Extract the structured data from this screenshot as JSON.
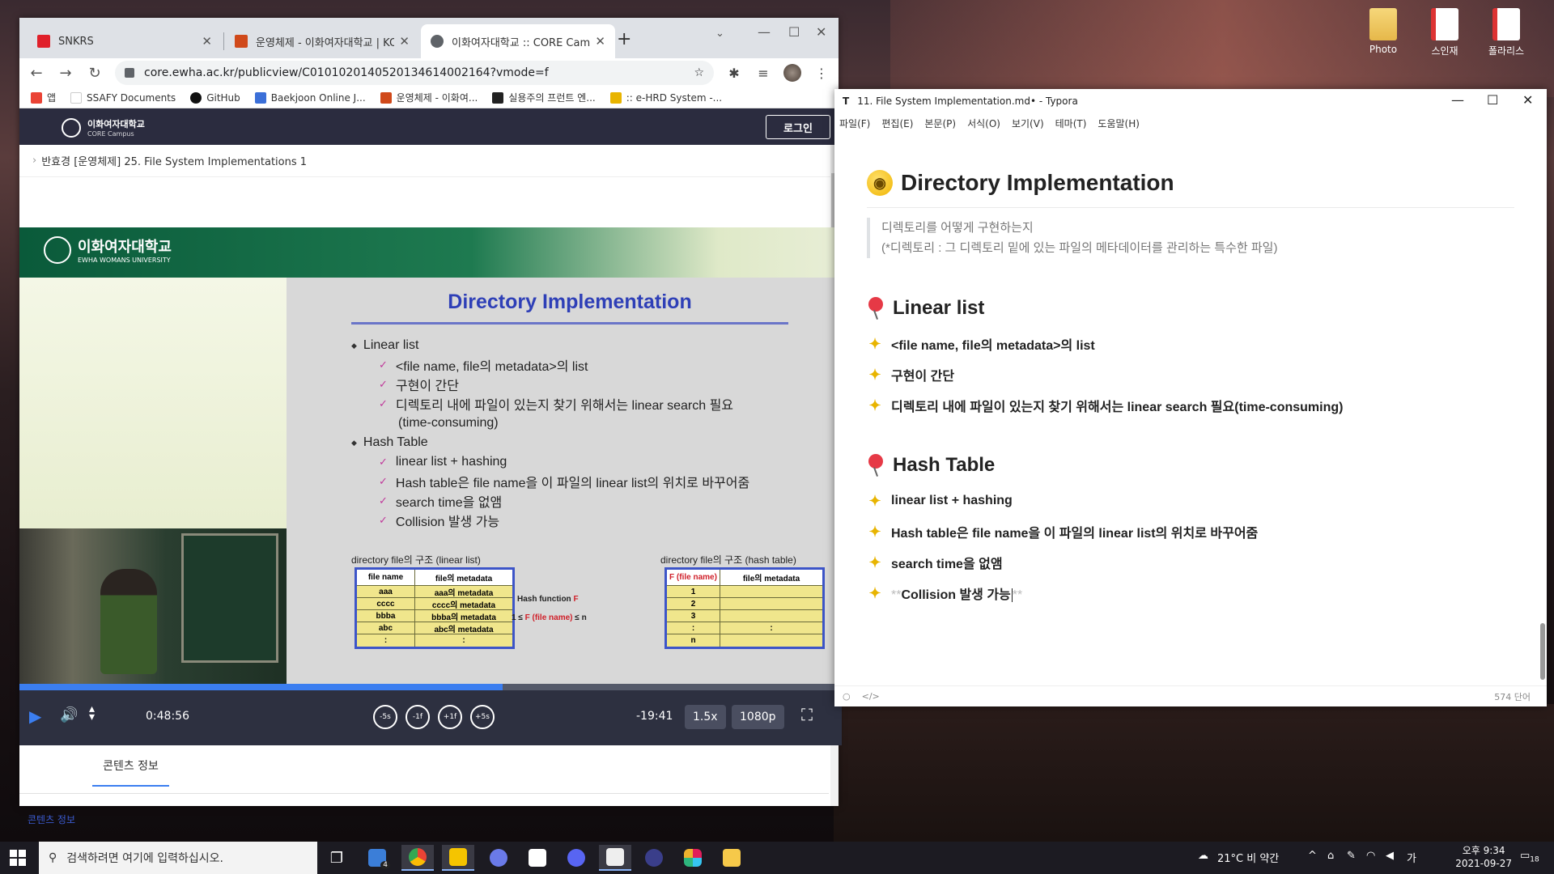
{
  "desktop": {
    "icons": [
      {
        "label": "Photo"
      },
      {
        "label": "스인재"
      },
      {
        "label": "폴라리스"
      }
    ]
  },
  "browser": {
    "tabs": [
      {
        "label": "SNKRS",
        "color": "#e0202a"
      },
      {
        "label": "운영체제 - 이화여자대학교 | KO",
        "color": "#d0491a"
      },
      {
        "label": "이화여자대학교 :: CORE Campus",
        "color": "#5f6368"
      }
    ],
    "url": "core.ewha.ac.kr/publicview/C0101020140520134614002164?vmode=f",
    "bookmarks": [
      {
        "label": "앱",
        "color": "#ea4335"
      },
      {
        "label": "SSAFY Documents",
        "color": "#ffffff"
      },
      {
        "label": "GitHub",
        "color": "#111111"
      },
      {
        "label": "Baekjoon Online J...",
        "color": "#3b6fd8"
      },
      {
        "label": "운영체제 - 이화여...",
        "color": "#d0491a"
      },
      {
        "label": "실용주의 프런트 엔...",
        "color": "#222222"
      },
      {
        "label": ":: e-HRD System -...",
        "color": "#e8b400"
      }
    ]
  },
  "site": {
    "logo_title": "이화여자대학교",
    "logo_sub": "CORE Campus",
    "login": "로그인",
    "breadcrumb": "반효경 [운영체제] 25. File System Implementations 1",
    "tab_label": "콘텐츠 정보",
    "tab_sub": "콘텐츠 정보"
  },
  "slide": {
    "univ_name": "이화여자대학교",
    "univ_en": "EWHA WOMANS UNIVERSITY",
    "title": "Directory Implementation",
    "bullets": [
      {
        "level": 1,
        "text": "Linear list"
      },
      {
        "level": 2,
        "text": "<file name, file의 metadata>의 list"
      },
      {
        "level": 2,
        "text": "구현이 간단"
      },
      {
        "level": 2,
        "text": "디렉토리 내에 파일이 있는지 찾기 위해서는 linear search 필요"
      },
      {
        "level": 3,
        "text": "(time-consuming)"
      },
      {
        "level": 1,
        "text": "Hash Table"
      },
      {
        "level": 2,
        "text": "linear list + hashing"
      },
      {
        "level": 2,
        "text": "Hash table은 file name을 이 파일의 linear list의 위치로 바꾸어줌"
      },
      {
        "level": 2,
        "text": "search time을 없앰"
      },
      {
        "level": 2,
        "text": "Collision 발생 가능"
      }
    ],
    "linear_caption": "directory file의 구조 (linear list)",
    "linear_table": {
      "headers": [
        "file name",
        "file의 metadata"
      ],
      "rows": [
        [
          "aaa",
          "aaa의 metadata"
        ],
        [
          "cccc",
          "cccc의 metadata"
        ],
        [
          "bbba",
          "bbba의 metadata"
        ],
        [
          "abc",
          "abc의 metadata"
        ],
        [
          ":",
          ":"
        ]
      ]
    },
    "hash_caption": "directory file의 구조 (hash table)",
    "hash_table": {
      "headers": [
        "F (file name)",
        "file의 metadata"
      ],
      "rows": [
        [
          "1",
          ""
        ],
        [
          "2",
          ""
        ],
        [
          "3",
          ""
        ],
        [
          ":",
          ":"
        ],
        [
          "n",
          ""
        ]
      ]
    },
    "hash_fn_label": "Hash function",
    "hash_fn_symbol": "F",
    "hash_range_left": "1 ≤",
    "hash_range_mid": "F (file name)",
    "hash_range_right": "≤ n"
  },
  "player": {
    "elapsed": "0:48:56",
    "remaining": "-19:41",
    "progress": 0.588,
    "speed": "1.5x",
    "quality": "1080p",
    "skip_buttons": [
      "-5s",
      "-1f",
      "+1f",
      "+5s"
    ]
  },
  "typora": {
    "title": "11. File System Implementation.md• - Typora",
    "menu": [
      "파일(F)",
      "편집(E)",
      "본문(P)",
      "서식(O)",
      "보기(V)",
      "테마(T)",
      "도움말(H)"
    ],
    "h1": "Directory Implementation",
    "quote": [
      "디렉토리를 어떻게 구현하는지",
      "(*디렉토리 : 그 디렉토리 밑에 있는 파일의 메타데이터를 관리하는 특수한 파일)"
    ],
    "sections": [
      {
        "title": "Linear list",
        "items": [
          "<file name, file의 metadata>의 list",
          "구현이 간단",
          "디렉토리 내에 파일이 있는지 찾기 위해서는 linear search 필요(time-consuming)"
        ]
      },
      {
        "title": "Hash Table",
        "items": [
          "linear list + hashing",
          "Hash table은 file name을 이 파일의 linear list의 위치로 바꾸어줌",
          "search time을 없앰"
        ]
      }
    ],
    "last_item_mark": "**",
    "last_item_text": "Collision 발생 가능",
    "word_count": "574 단어"
  },
  "taskbar": {
    "search_placeholder": "검색하려면 여기에 입력하십시오.",
    "weather": "21°C  비 약간",
    "ime": "가",
    "time": "오후 9:34",
    "date": "2021-09-27",
    "notif_count": "18",
    "mail_badge": "4"
  }
}
